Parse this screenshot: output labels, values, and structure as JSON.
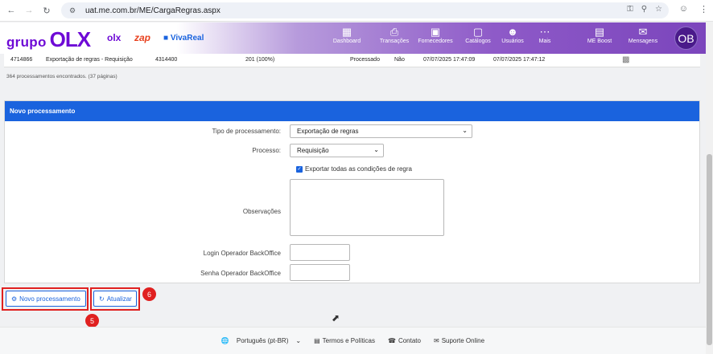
{
  "browser": {
    "url": "uat.me.com.br/ME/CargaRegras.aspx"
  },
  "header": {
    "brand_grupo": "grupo",
    "brand_olx": "OLX",
    "brand_olx_small": "olx",
    "brand_zap": "zap",
    "brand_vivareal": "VivaReal",
    "nav": [
      {
        "label": "Dashboard",
        "icon": "dashboard-icon"
      },
      {
        "label": "Transações",
        "icon": "transactions-icon"
      },
      {
        "label": "Fornecedores",
        "icon": "suppliers-icon"
      },
      {
        "label": "Catálogos",
        "icon": "catalog-icon"
      },
      {
        "label": "Usuários",
        "icon": "users-icon"
      },
      {
        "label": "Mais",
        "icon": "more-icon"
      },
      {
        "label": "ME Boost",
        "icon": "chart-icon"
      },
      {
        "label": "Mensagens",
        "icon": "messages-icon"
      }
    ],
    "avatar": "OB"
  },
  "table": {
    "row": {
      "id": "4714866",
      "type": "Exportação de regras - Requisição",
      "ref": "4314400",
      "count": "201 (100%)",
      "status": "Processado",
      "flag": "Não",
      "start": "07/07/2025 17:47:09",
      "end": "07/07/2025 17:47:12"
    },
    "found_text": "364 processamentos encontrados. (37 páginas)"
  },
  "form": {
    "title": "Novo processamento",
    "tipo_label": "Tipo de processamento:",
    "tipo_value": "Exportação de regras",
    "processo_label": "Processo:",
    "processo_value": "Requisição",
    "export_all_label": "Exportar todas as condições de regra",
    "observacoes_label": "Observações",
    "login_label": "Login Operador BackOffice",
    "senha_label": "Senha Operador BackOffice"
  },
  "actions": {
    "new_label": "Novo processamento",
    "refresh_label": "Atualizar",
    "badge_new": "5",
    "badge_refresh": "6"
  },
  "footer": {
    "language": "Português (pt-BR)",
    "terms": "Termos e Políticas",
    "contact": "Contato",
    "support": "Suporte Online"
  },
  "colors": {
    "primary": "#1a63de",
    "brand": "#6e0ad6",
    "highlight": "#e02020"
  }
}
